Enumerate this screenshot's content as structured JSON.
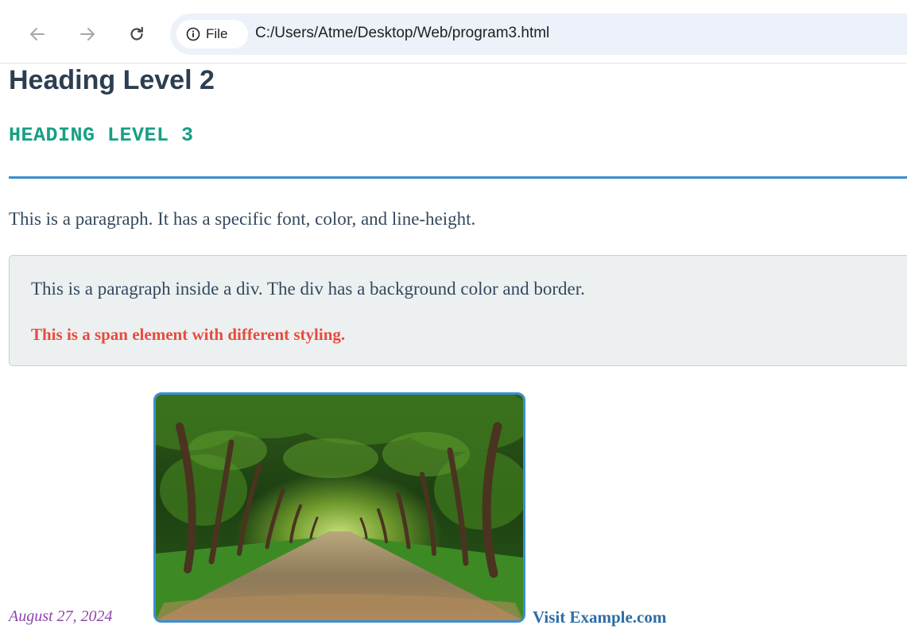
{
  "browser": {
    "site_chip_label": "File",
    "url": "C:/Users/Atme/Desktop/Web/program3.html",
    "icons": {
      "back": "arrow-left-icon",
      "forward": "arrow-right-icon",
      "reload": "reload-icon",
      "site_info": "info-icon"
    }
  },
  "page": {
    "heading2": "Heading Level 2",
    "heading3": "HEADING LEVEL 3",
    "paragraph": "This is a paragraph. It has a specific font, color, and line-height.",
    "styled_box": {
      "paragraph": "This is a paragraph inside a div. The div has a background color and border.",
      "span": "This is a span element with different styling."
    },
    "date": "August 27, 2024",
    "link_text": "Visit Example.com"
  },
  "colors": {
    "heading2": "#2c3e50",
    "heading3": "#16a085",
    "divider": "#3a8fd0",
    "text": "#34495e",
    "box_background": "#ecf0f1",
    "span": "#e74c3c",
    "date": "#8e44ad",
    "link": "#2e6da4"
  }
}
